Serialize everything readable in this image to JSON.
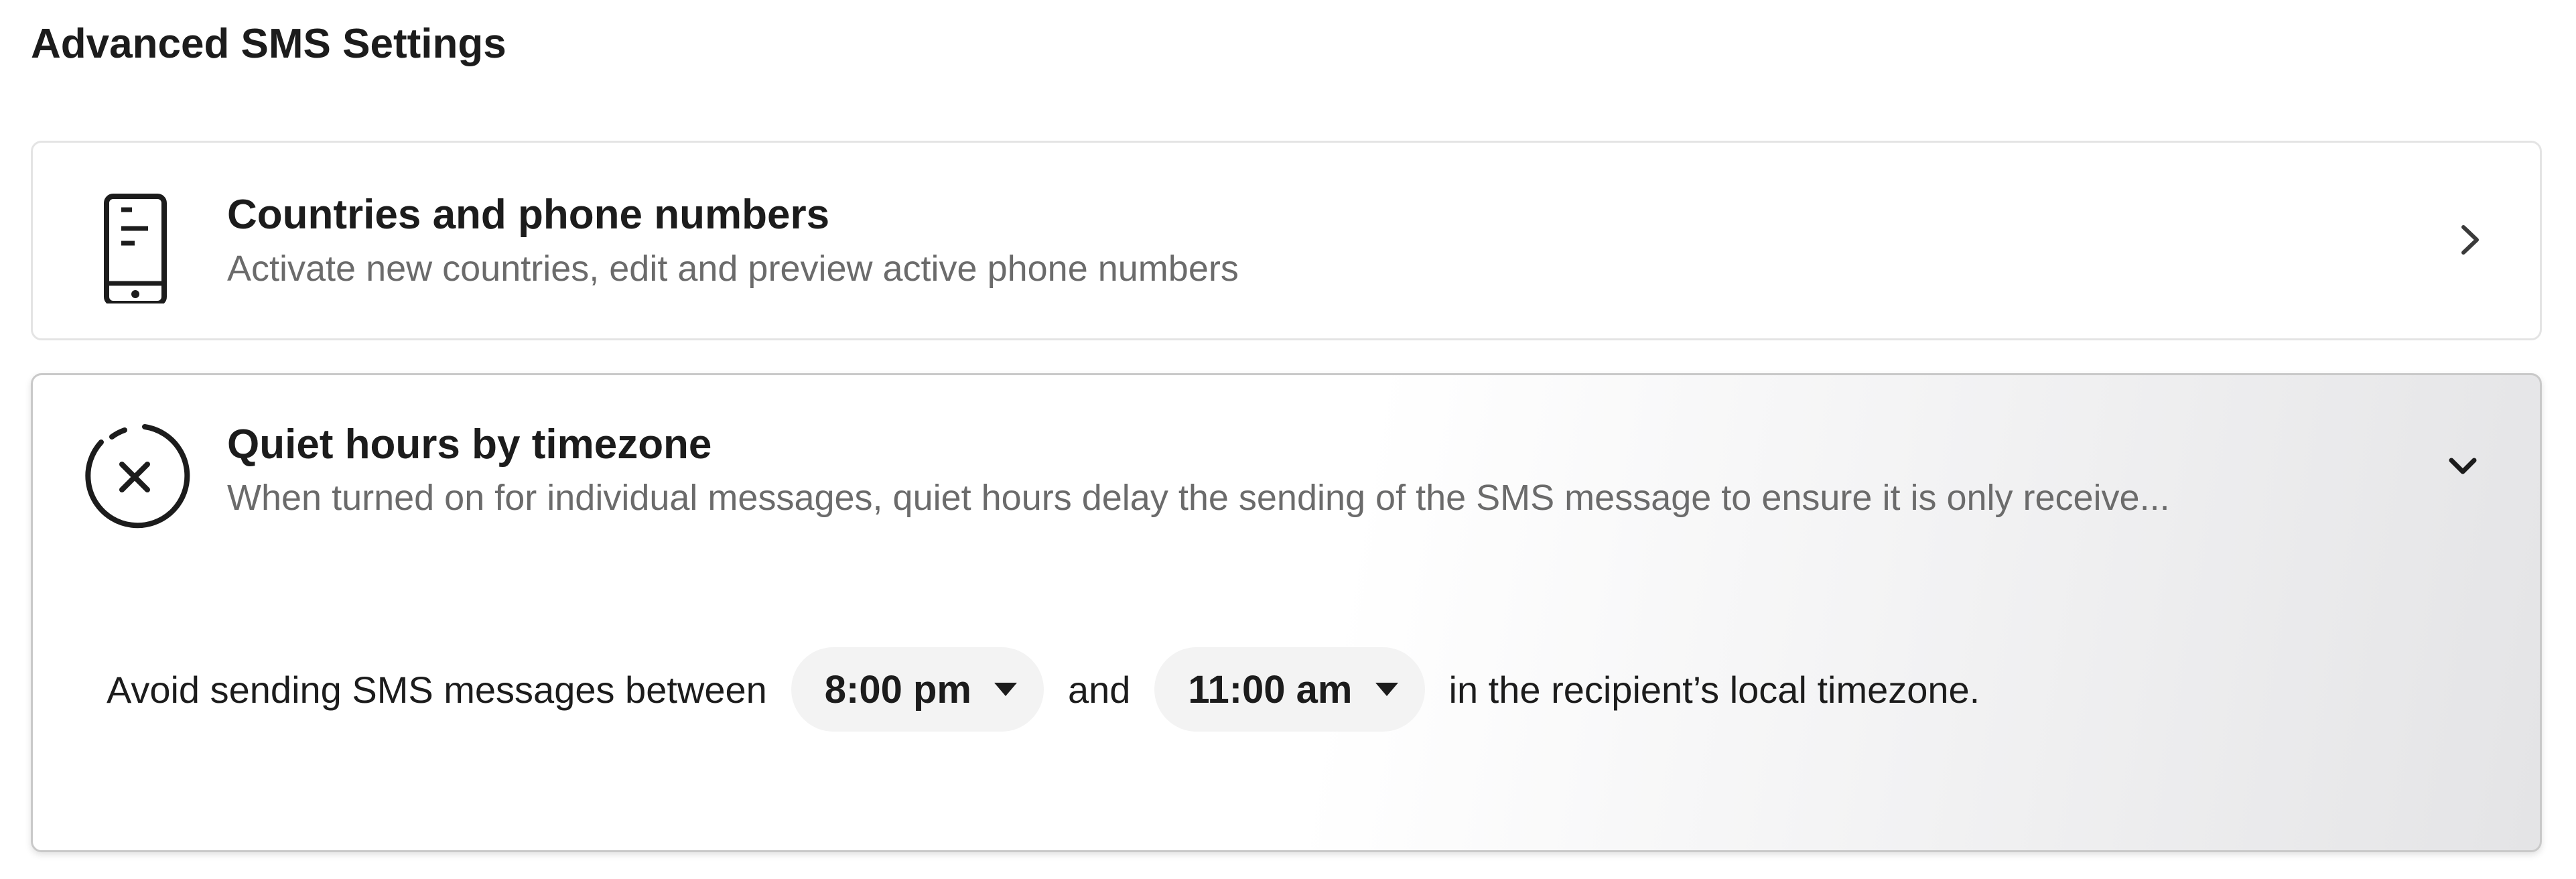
{
  "page": {
    "title": "Advanced SMS Settings"
  },
  "countries_card": {
    "icon": "phone-icon",
    "title": "Countries and phone numbers",
    "description": "Activate new countries, edit and preview active phone numbers",
    "chevron": "chevron-right-icon"
  },
  "quiet_hours_card": {
    "icon": "quiet-hours-icon",
    "title": "Quiet hours by timezone",
    "description": "When turned on for individual messages, quiet hours delay the sending of the SMS message to ensure it is only receive...",
    "chevron": "chevron-down-icon",
    "expanded": true,
    "rule": {
      "prefix": "Avoid sending SMS messages between",
      "start_time": "8:00 pm",
      "connector": "and",
      "end_time": "11:00 am",
      "suffix": "in the recipient’s local timezone."
    }
  }
}
